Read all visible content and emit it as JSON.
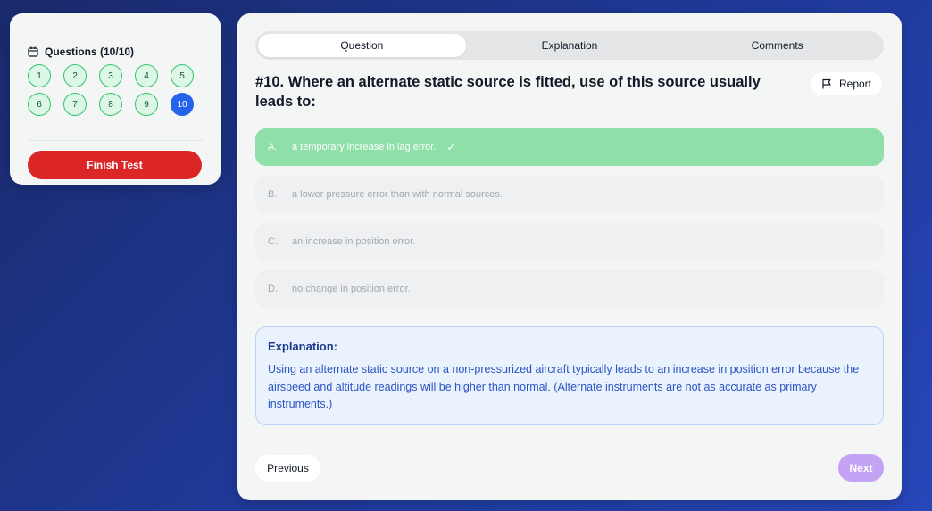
{
  "sidebar": {
    "heading": "Questions (10/10)",
    "question_numbers": [
      "1",
      "2",
      "3",
      "4",
      "5",
      "6",
      "7",
      "8",
      "9",
      "10"
    ],
    "current_question": "10",
    "finish_label": "Finish Test",
    "icon": "calendar-icon"
  },
  "tabs": [
    {
      "label": "Question",
      "active": true
    },
    {
      "label": "Explanation",
      "active": false
    },
    {
      "label": "Comments",
      "active": false
    }
  ],
  "question": {
    "title": "#10. Where an alternate static source is fitted, use of this source usually leads to:",
    "report_label": "Report",
    "report_icon": "flag-icon"
  },
  "options": [
    {
      "letter": "A.",
      "text": "a temporary increase in lag error.",
      "correct": true,
      "check": "✓"
    },
    {
      "letter": "B.",
      "text": "a lower pressure error than with normal sources.",
      "correct": false
    },
    {
      "letter": "C.",
      "text": "an increase in position error.",
      "correct": false
    },
    {
      "letter": "D.",
      "text": "no change in position error.",
      "correct": false
    }
  ],
  "explanation": {
    "title": "Explanation:",
    "body": "Using an alternate static source on a non-pressurized aircraft typically leads to an increase in position error because the airspeed and altitude readings will be higher than normal. (Alternate instruments are not as accurate as primary instruments.)"
  },
  "navigation": {
    "previous_label": "Previous",
    "next_label": "Next"
  },
  "colors": {
    "correct_option": "#8ee0a8",
    "answered_question": "#dcf7e6",
    "current_question": "#2563eb",
    "finish_button": "#dc2626",
    "next_button": "#c4a3f5"
  }
}
